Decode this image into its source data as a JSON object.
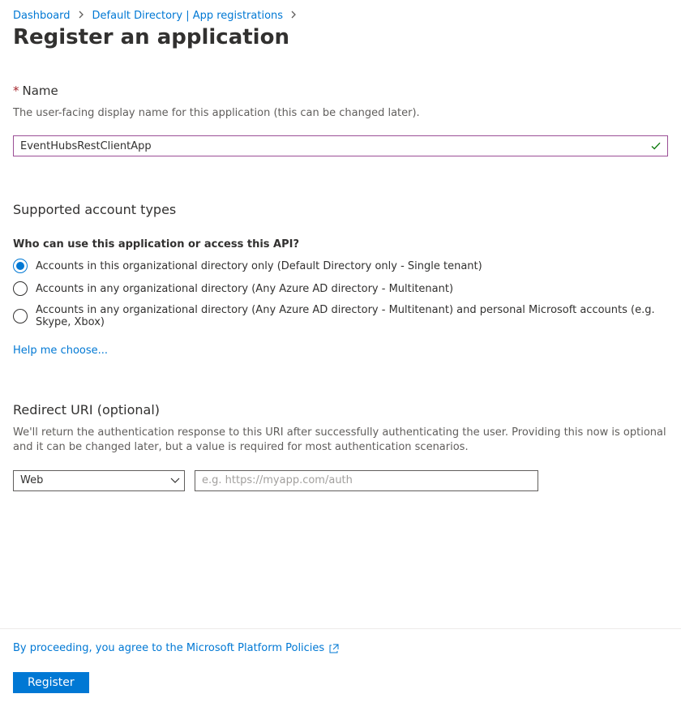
{
  "breadcrumb": {
    "dashboard": "Dashboard",
    "directory": "Default Directory | App registrations"
  },
  "page_title": "Register an application",
  "name_section": {
    "label": "Name",
    "help": "The user-facing display name for this application (this can be changed later).",
    "value": "EventHubsRestClientApp"
  },
  "account_types": {
    "heading": "Supported account types",
    "subheading": "Who can use this application or access this API?",
    "options": [
      "Accounts in this organizational directory only (Default Directory only - Single tenant)",
      "Accounts in any organizational directory (Any Azure AD directory - Multitenant)",
      "Accounts in any organizational directory (Any Azure AD directory - Multitenant) and personal Microsoft accounts (e.g. Skype, Xbox)"
    ],
    "help_link": "Help me choose..."
  },
  "redirect": {
    "heading": "Redirect URI (optional)",
    "help": "We'll return the authentication response to this URI after successfully authenticating the user. Providing this now is optional and it can be changed later, but a value is required for most authentication scenarios.",
    "type_selected": "Web",
    "uri_placeholder": "e.g. https://myapp.com/auth"
  },
  "footer": {
    "agree_prefix": "By proceeding, you agree to the ",
    "agree_link": "Microsoft Platform Policies",
    "register": "Register"
  }
}
